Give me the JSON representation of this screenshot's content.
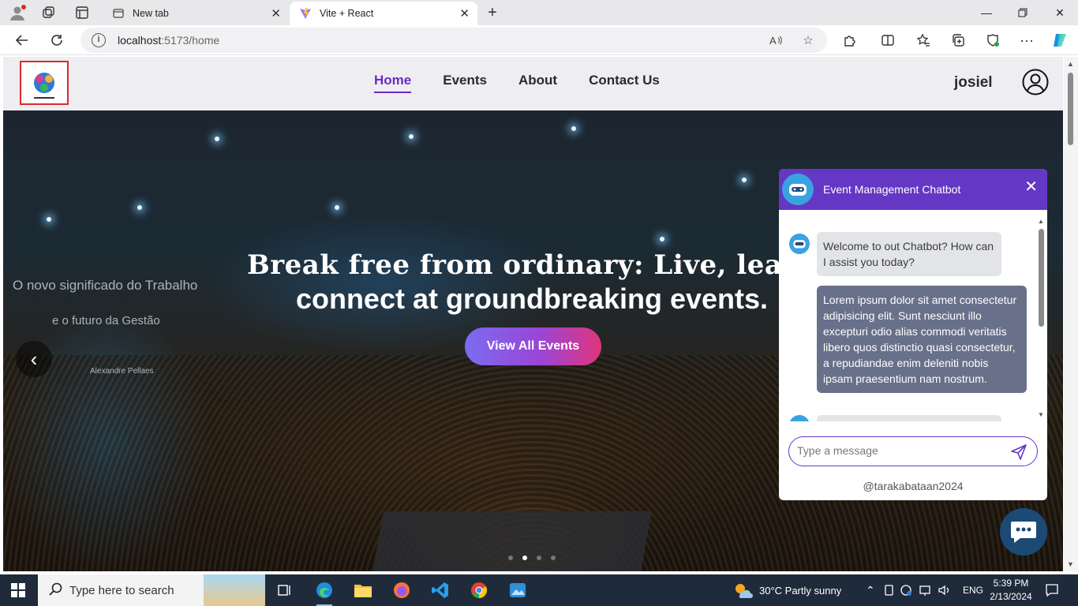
{
  "browser": {
    "tabs": [
      {
        "title": "New tab",
        "active": false
      },
      {
        "title": "Vite + React",
        "active": true
      }
    ],
    "url_host": "localhost",
    "url_path": ":5173/home"
  },
  "site": {
    "nav": [
      {
        "label": "Home",
        "active": true
      },
      {
        "label": "Events",
        "active": false
      },
      {
        "label": "About",
        "active": false
      },
      {
        "label": "Contact Us",
        "active": false
      }
    ],
    "username": "josiel",
    "hero": {
      "title_line1": "Break free from ordinary: Live, learn",
      "title_line2": "connect at groundbreaking events.",
      "cta_label": "View All Events",
      "prev_arrow": "‹",
      "screen_text_1": "O novo significado do Trabalho",
      "screen_text_2": "e o futuro da Gestão",
      "screen_text_3": "Alexandre Pellaes"
    }
  },
  "chatbot": {
    "title": "Event Management Chatbot",
    "close_glyph": "✕",
    "messages": [
      {
        "from": "bot",
        "text": "Welcome to out Chatbot? How can I assist you today?"
      },
      {
        "from": "user",
        "text": "Lorem ipsum dolor sit amet consectetur adipisicing elit. Sunt nesciunt illo excepturi odio alias commodi veritatis libero quos distinctio quasi consectetur, a repudiandae enim deleniti nobis ipsam praesentium nam nostrum."
      }
    ],
    "input_placeholder": "Type a message",
    "footer": "@tarakabataan2024"
  },
  "taskbar": {
    "search_placeholder": "Type here to search",
    "weather": "30°C  Partly sunny",
    "language": "ENG",
    "time": "5:39 PM",
    "date": "2/13/2024"
  },
  "colors": {
    "accent": "#6437c4",
    "cta_gradient_start": "#7b6cf0",
    "cta_gradient_end": "#e0357c",
    "bot_avatar": "#3aa2e0"
  }
}
